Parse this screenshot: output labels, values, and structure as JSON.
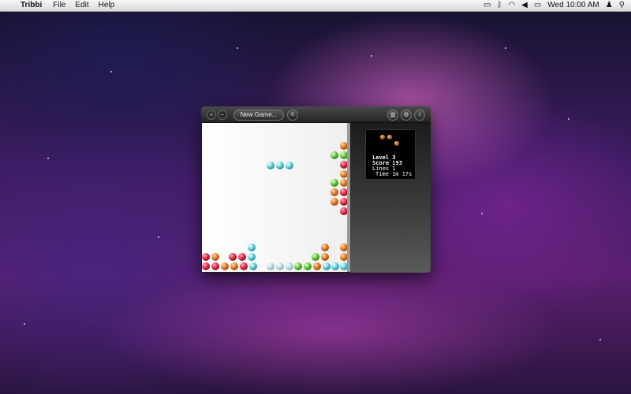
{
  "menubar": {
    "app_name": "Tribbi",
    "items": [
      "File",
      "Edit",
      "Help"
    ],
    "clock": "Wed 10:00 AM"
  },
  "window": {
    "new_game_label": "New Game...",
    "pause_symbol": "II",
    "close_symbol": "×",
    "minimize_symbol": "−",
    "scores_icon": "▥",
    "settings_icon": "⚙",
    "info_icon": "i"
  },
  "game": {
    "level_label": "Level 3",
    "score_label": "Score 193",
    "lines_label": "Lines 1",
    "time_label": "Time 1m 17s",
    "next_piece": [
      "orange",
      "orange",
      "orange"
    ],
    "falling_piece": [
      "cyan",
      "cyan",
      "cyan"
    ],
    "colors": {
      "orange": "#f07a1a",
      "red": "#e8203c",
      "green": "#5ad02a",
      "cyan": "#55d8e8"
    }
  }
}
